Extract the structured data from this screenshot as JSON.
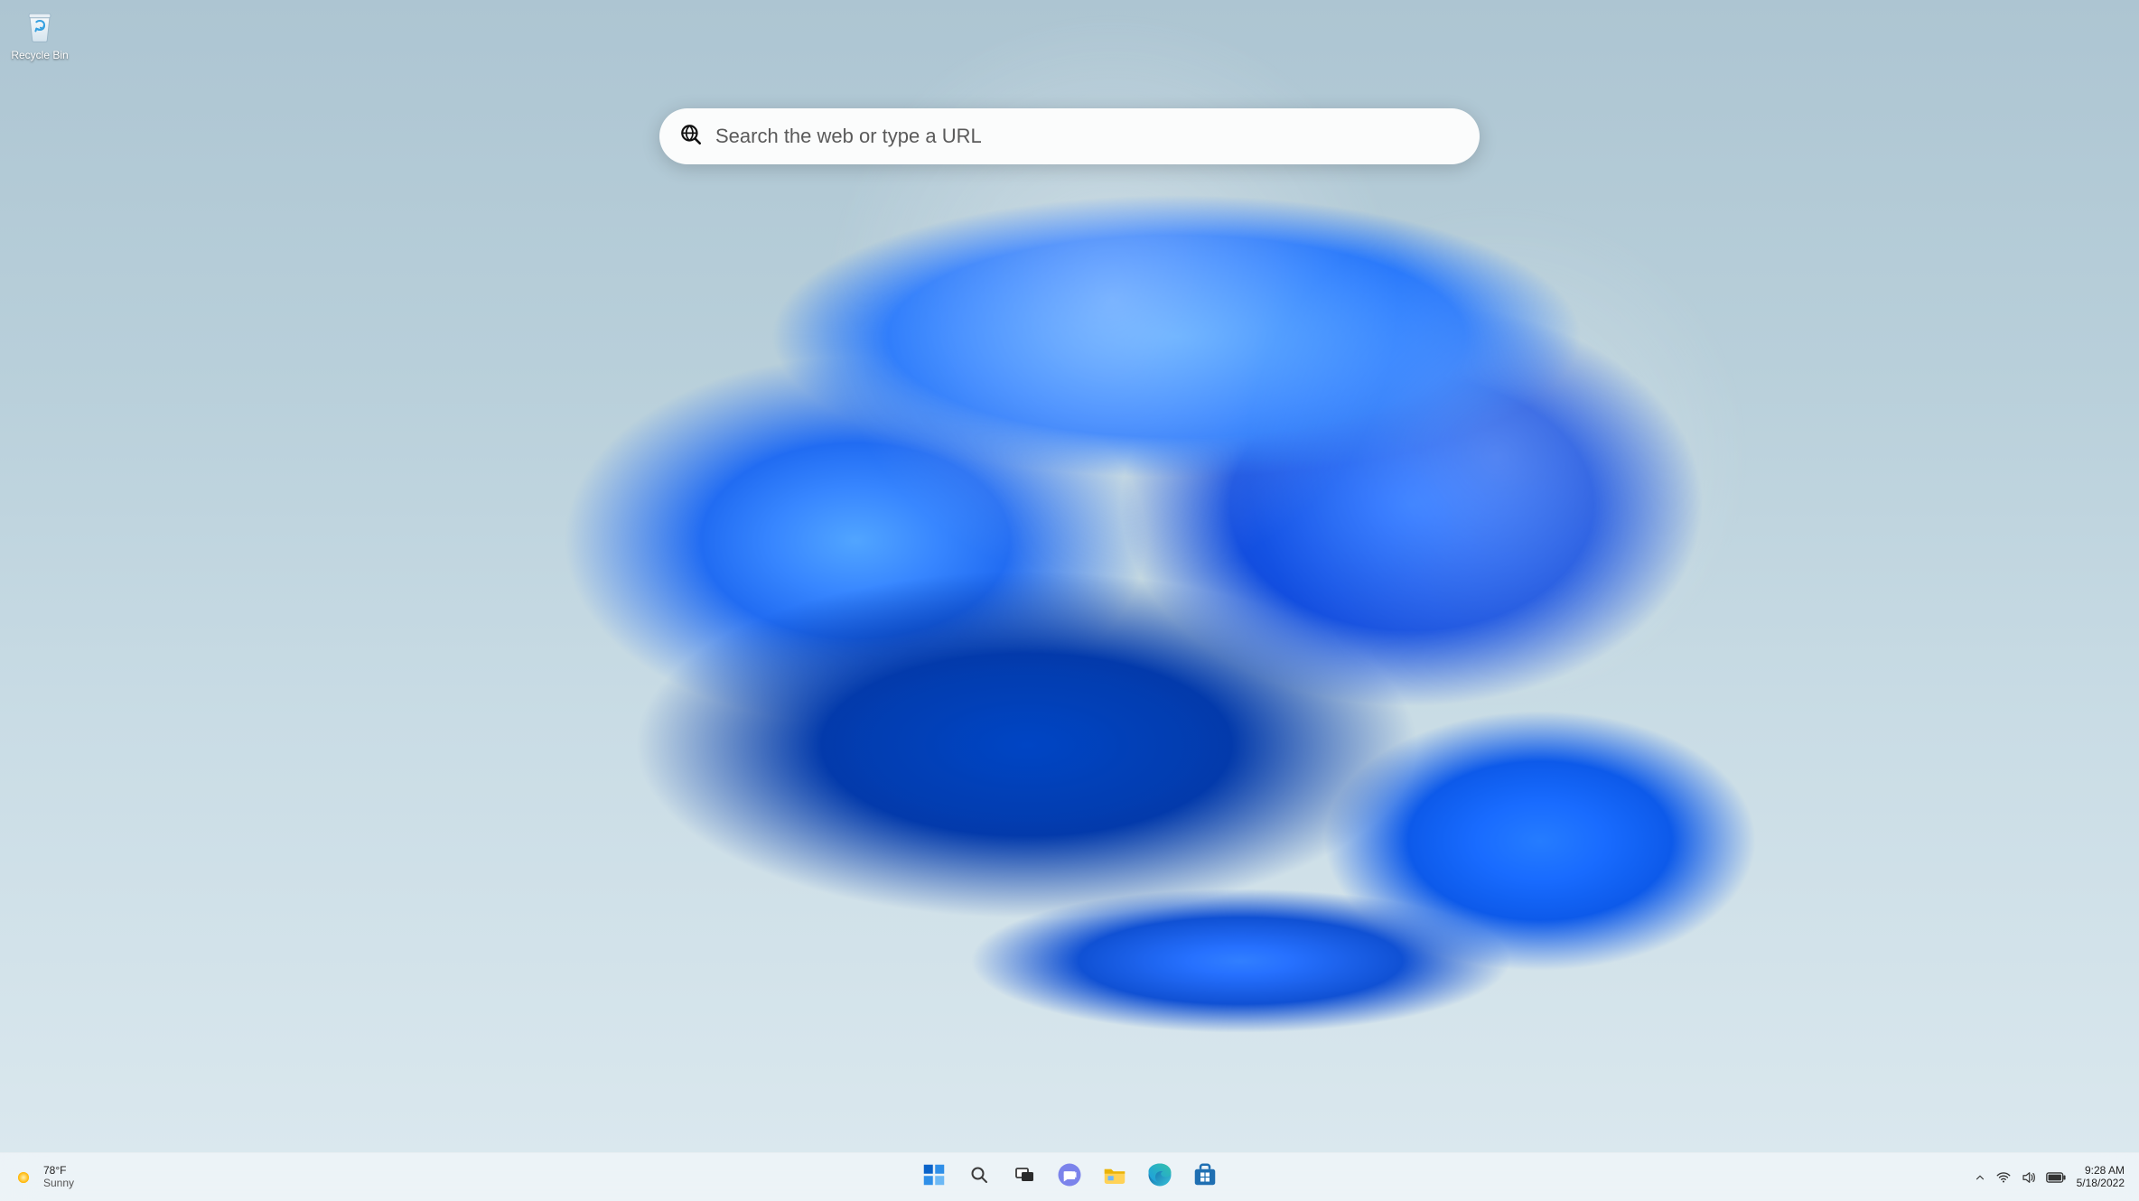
{
  "desktop": {
    "icons": [
      {
        "name": "recycle-bin",
        "label": "Recycle Bin"
      }
    ],
    "search": {
      "placeholder": "Search the web or type a URL",
      "value": ""
    }
  },
  "taskbar": {
    "weather": {
      "temperature": "78°F",
      "condition": "Sunny"
    },
    "pinned": [
      {
        "name": "start"
      },
      {
        "name": "search"
      },
      {
        "name": "task-view"
      },
      {
        "name": "chat"
      },
      {
        "name": "file-explorer"
      },
      {
        "name": "edge"
      },
      {
        "name": "microsoft-store"
      }
    ],
    "tray": {
      "items": [
        {
          "name": "show-hidden-icons"
        },
        {
          "name": "wifi"
        },
        {
          "name": "sound"
        },
        {
          "name": "battery"
        }
      ]
    },
    "clock": {
      "time": "9:28 AM",
      "date": "5/18/2022"
    }
  }
}
